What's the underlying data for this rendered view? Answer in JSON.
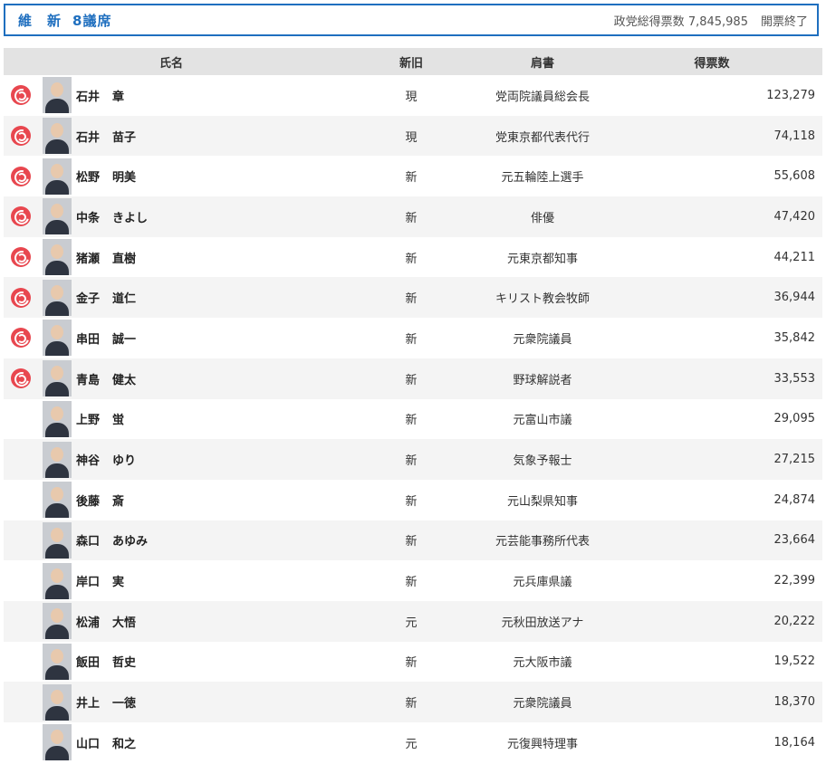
{
  "header": {
    "party": "維　新",
    "seats": "8議席",
    "total_label": "政党総得票数",
    "total_votes": "7,845,985",
    "status": "開票終了"
  },
  "columns": {
    "name": "氏名",
    "status": "新旧",
    "title": "肩書",
    "votes": "得票数"
  },
  "candidates": [
    {
      "surname": "石井",
      "given": "章",
      "status": "現",
      "title": "党両院議員総会長",
      "votes": "123,279",
      "elected": true
    },
    {
      "surname": "石井",
      "given": "苗子",
      "status": "現",
      "title": "党東京都代表代行",
      "votes": "74,118",
      "elected": true
    },
    {
      "surname": "松野",
      "given": "明美",
      "status": "新",
      "title": "元五輪陸上選手",
      "votes": "55,608",
      "elected": true
    },
    {
      "surname": "中条",
      "given": "きよし",
      "status": "新",
      "title": "俳優",
      "votes": "47,420",
      "elected": true
    },
    {
      "surname": "猪瀬",
      "given": "直樹",
      "status": "新",
      "title": "元東京都知事",
      "votes": "44,211",
      "elected": true
    },
    {
      "surname": "金子",
      "given": "道仁",
      "status": "新",
      "title": "キリスト教会牧師",
      "votes": "36,944",
      "elected": true
    },
    {
      "surname": "串田",
      "given": "誠一",
      "status": "新",
      "title": "元衆院議員",
      "votes": "35,842",
      "elected": true
    },
    {
      "surname": "青島",
      "given": "健太",
      "status": "新",
      "title": "野球解説者",
      "votes": "33,553",
      "elected": true
    },
    {
      "surname": "上野",
      "given": "蛍",
      "status": "新",
      "title": "元富山市議",
      "votes": "29,095",
      "elected": false
    },
    {
      "surname": "神谷",
      "given": "ゆり",
      "status": "新",
      "title": "気象予報士",
      "votes": "27,215",
      "elected": false
    },
    {
      "surname": "後藤",
      "given": "斎",
      "status": "新",
      "title": "元山梨県知事",
      "votes": "24,874",
      "elected": false
    },
    {
      "surname": "森口",
      "given": "あゆみ",
      "status": "新",
      "title": "元芸能事務所代表",
      "votes": "23,664",
      "elected": false
    },
    {
      "surname": "岸口",
      "given": "実",
      "status": "新",
      "title": "元兵庫県議",
      "votes": "22,399",
      "elected": false
    },
    {
      "surname": "松浦",
      "given": "大悟",
      "status": "元",
      "title": "元秋田放送アナ",
      "votes": "20,222",
      "elected": false
    },
    {
      "surname": "飯田",
      "given": "哲史",
      "status": "新",
      "title": "元大阪市議",
      "votes": "19,522",
      "elected": false
    },
    {
      "surname": "井上",
      "given": "一徳",
      "status": "新",
      "title": "元衆院議員",
      "votes": "18,370",
      "elected": false
    },
    {
      "surname": "山口",
      "given": "和之",
      "status": "元",
      "title": "元復興特理事",
      "votes": "18,164",
      "elected": false
    }
  ],
  "colors": {
    "accent": "#1f6fbf",
    "elected_mark": "#e8474f",
    "header_bg": "#e3e3e3",
    "row_alt": "#f4f4f4"
  }
}
